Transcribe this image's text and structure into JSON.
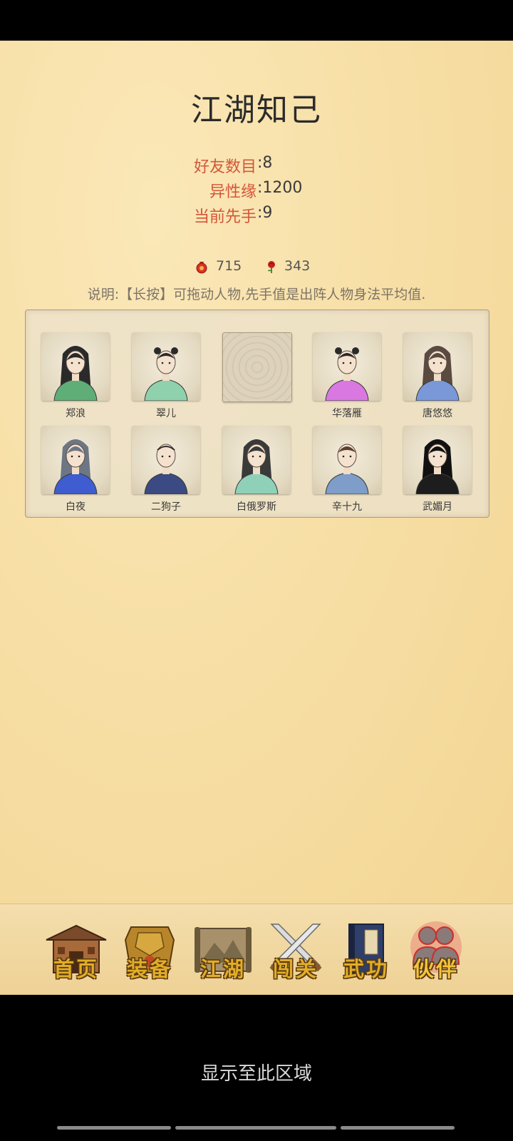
{
  "page": {
    "title": "江湖知己"
  },
  "stats": [
    {
      "label": "好友数目",
      "value": ":8"
    },
    {
      "label": "异性缘",
      "value": ":1200"
    },
    {
      "label": "当前先手",
      "value": ":9"
    }
  ],
  "currency": {
    "coins": {
      "icon": "red-pouch-icon",
      "value": "715"
    },
    "roses": {
      "icon": "rose-icon",
      "value": "343"
    }
  },
  "note": "说明:【长按】可拖动人物,先手值是出阵人物身法平均值.",
  "characters": [
    {
      "name": "郑浪",
      "robe": "#5fae78",
      "hair": "#2a2a2a",
      "style": "long"
    },
    {
      "name": "翠儿",
      "robe": "#8fd1ad",
      "hair": "#2a2a2a",
      "style": "buns"
    },
    {
      "name": "",
      "robe": "",
      "hair": "",
      "style": "empty"
    },
    {
      "name": "华落雁",
      "robe": "#d978e0",
      "hair": "#2a2a2a",
      "style": "buns"
    },
    {
      "name": "唐悠悠",
      "robe": "#7a98d8",
      "hair": "#5a4a40",
      "style": "long"
    },
    {
      "name": "白夜",
      "robe": "#3f5dd0",
      "hair": "#6d7683",
      "style": "long"
    },
    {
      "name": "二狗子",
      "robe": "#3b4a82",
      "hair": "#2a2a2a",
      "style": "bald"
    },
    {
      "name": "白俄罗斯",
      "robe": "#8fd1b8",
      "hair": "#3a3a3a",
      "style": "long"
    },
    {
      "name": "辛十九",
      "robe": "#7e9dc8",
      "hair": "#5a4030",
      "style": "short"
    },
    {
      "name": "武媚月",
      "robe": "#1d1d1d",
      "hair": "#111111",
      "style": "long"
    }
  ],
  "nav": [
    {
      "label": "首页",
      "icon": "house-icon",
      "active": false
    },
    {
      "label": "装备",
      "icon": "armor-icon",
      "active": false
    },
    {
      "label": "江湖",
      "icon": "scroll-map-icon",
      "active": false
    },
    {
      "label": "闯关",
      "icon": "crossed-swords-icon",
      "active": false
    },
    {
      "label": "武功",
      "icon": "martial-book-icon",
      "active": false
    },
    {
      "label": "伙伴",
      "icon": "partners-icon",
      "active": true
    }
  ],
  "footer": {
    "text": "显示至此区域"
  }
}
